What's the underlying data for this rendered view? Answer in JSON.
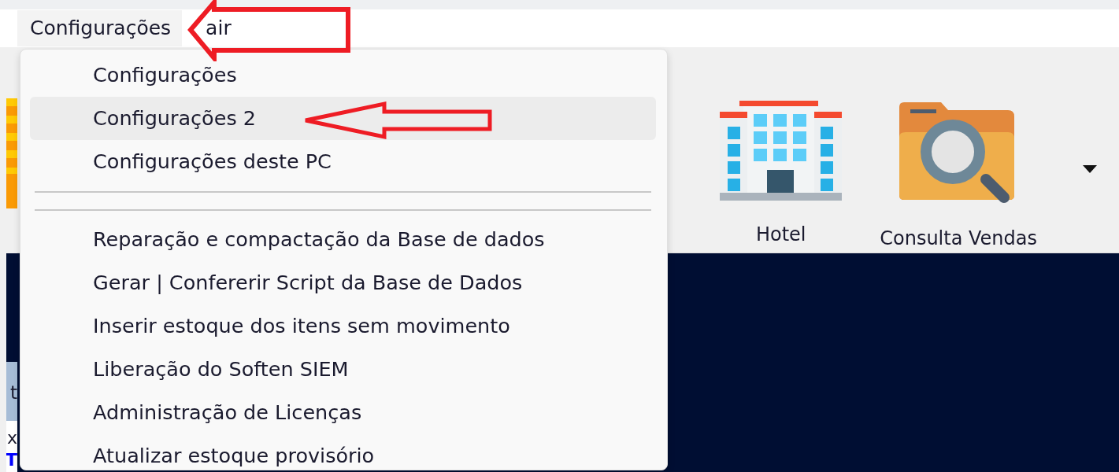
{
  "menu_bar": [
    {
      "label": "Configurações",
      "selected": true
    },
    {
      "label": "air",
      "selected": false
    }
  ],
  "dropdown": {
    "items": [
      {
        "kind": "item",
        "label": "Configurações",
        "selected": false
      },
      {
        "kind": "item",
        "label": "Configurações 2",
        "selected": true
      },
      {
        "kind": "item",
        "label": "Configurações deste PC",
        "selected": false
      },
      {
        "kind": "separator"
      },
      {
        "kind": "item",
        "label": "Reparação e compactação da Base de dados",
        "selected": false
      },
      {
        "kind": "item",
        "label": "Gerar | Confererir Script da Base de Dados",
        "selected": false
      },
      {
        "kind": "item",
        "label": "Inserir estoque dos itens sem movimento",
        "selected": false
      },
      {
        "kind": "item",
        "label": "Liberação do Soften SIEM",
        "selected": false
      },
      {
        "kind": "item",
        "label": "Administração de Licenças",
        "selected": false
      },
      {
        "kind": "item",
        "label": "Atualizar estoque provisório",
        "selected": false
      }
    ]
  },
  "toolbar": {
    "buttons": [
      {
        "kind": "hotel",
        "label": "Hotel"
      },
      {
        "kind": "sales-search",
        "label": "Consulta Vendas"
      }
    ]
  },
  "left_fragments": [
    {
      "kind": "plain",
      "text": "t"
    },
    {
      "kind": "plain",
      "text": "x"
    },
    {
      "kind": "link",
      "text": "T"
    }
  ]
}
